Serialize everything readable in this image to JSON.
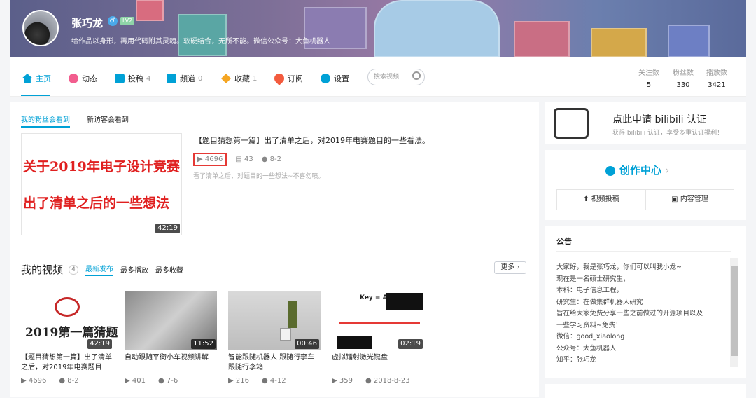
{
  "profile": {
    "name": "张巧龙",
    "gender_icon": "♂",
    "level": "LV2",
    "signature": "给作品以身形，再用代码附其灵魂。软硬结合，无所不能。微信公众号：大鱼机器人"
  },
  "nav": {
    "home": "主页",
    "dynamic": "动态",
    "uploads": "投稿",
    "uploads_count": "4",
    "channels": "频道",
    "channels_count": "0",
    "favorites": "收藏",
    "favorites_count": "1",
    "subscribe": "订阅",
    "settings": "设置",
    "search_placeholder": "搜索视频"
  },
  "stats": {
    "following_label": "关注数",
    "following": "5",
    "fans_label": "粉丝数",
    "fans": "330",
    "plays_label": "播放数",
    "plays": "3421"
  },
  "featured": {
    "tab_fans": "我的粉丝会看到",
    "tab_visitors": "新访客会看到",
    "thumb_line1": "关于2019年电子设计竞赛",
    "thumb_line2": "出了清单之后的一些想法",
    "duration": "42:19",
    "title": "【题目猜想第一篇】出了清单之后，对2019年电赛题目的一些看法。",
    "plays": "4696",
    "comments": "43",
    "date": "8-2",
    "desc": "看了清单之后，对题目的一些想法~不喜勿喷。"
  },
  "videos_section": {
    "title": "我的视频",
    "count": "4",
    "sort_new": "最新发布",
    "sort_plays": "最多播放",
    "sort_favs": "最多收藏",
    "more": "更多"
  },
  "videos": [
    {
      "title": "【题目猜想第一篇】出了清单之后，对2019年电赛题目",
      "duration": "42:19",
      "plays": "4696",
      "date": "8-2",
      "thumb_text": "2019第一篇猜题"
    },
    {
      "title": "自动跟随平衡小车视频讲解",
      "duration": "11:52",
      "plays": "401",
      "date": "7-6"
    },
    {
      "title": "智能跟随机器人 跟随行李车 跟随行李箱",
      "duration": "00:46",
      "plays": "216",
      "date": "4-12"
    },
    {
      "title": "虚拟镭射激光键盘",
      "duration": "02:19",
      "plays": "359",
      "date": "2018-8-23",
      "thumb_text": "Key = A"
    }
  ],
  "cert": {
    "title": "点此申请 bilibili 认证",
    "sub": "获得 bilibili 认证，享受多重认证福利！"
  },
  "creator": {
    "title": "创作中心",
    "upload": "视频投稿",
    "manage": "内容管理"
  },
  "notice": {
    "title": "公告",
    "lines": [
      "大家好，我是张巧龙，你们可以叫我小龙~",
      "现在是一名硕士研究生，",
      "本科：电子信息工程，",
      "研究生：在做集群机器人研究",
      "旨在给大家免费分享一些之前做过的开源项目以及",
      "一些学习资料~免费！",
      "微信：good_xiaolong",
      "公众号：大鱼机器人",
      "知乎：张巧龙"
    ]
  },
  "colors": {
    "accent": "#00a1d6",
    "highlight": "#e53935",
    "thumb_text": "#e02020"
  }
}
